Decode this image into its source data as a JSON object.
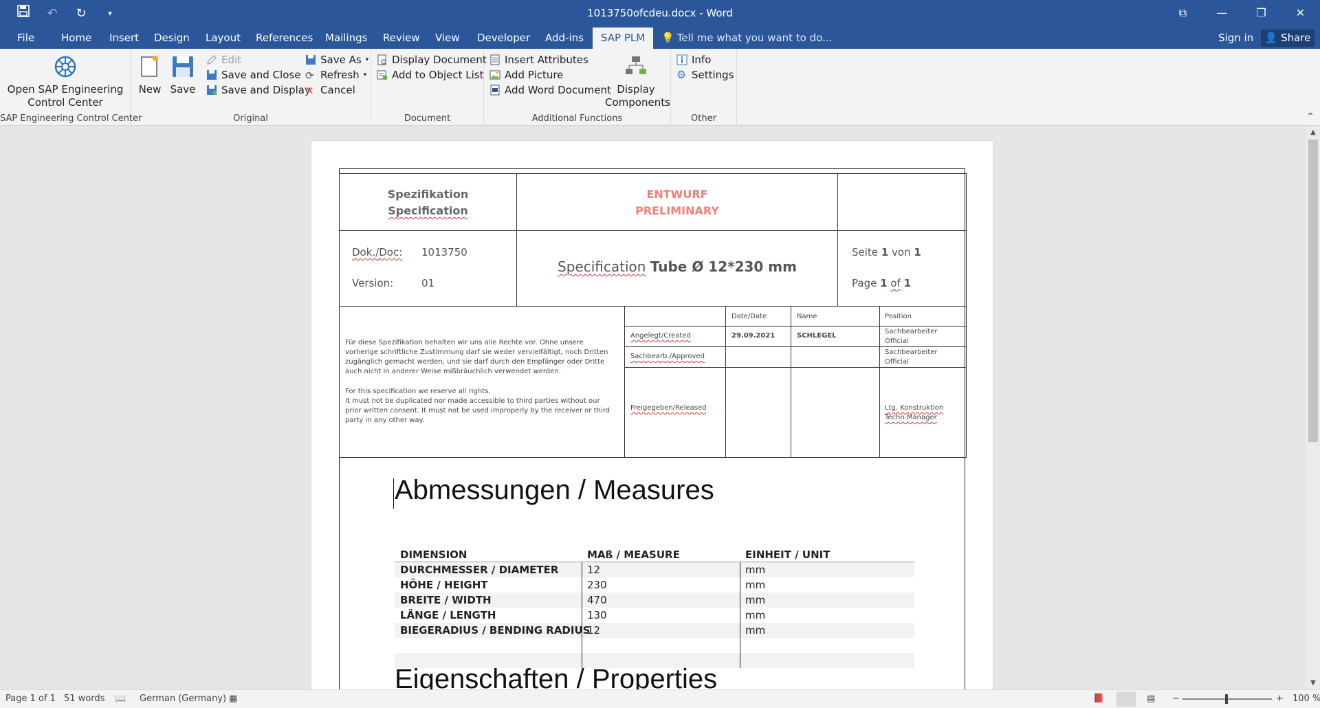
{
  "window": {
    "title": "1013750ofcdeu.docx - Word",
    "controls": [
      "ribbon-display-icon",
      "minimize-icon",
      "restore-icon",
      "close-icon"
    ]
  },
  "tabs": {
    "file": "File",
    "home": "Home",
    "insert": "Insert",
    "design": "Design",
    "layout": "Layout",
    "references": "References",
    "mailings": "Mailings",
    "review": "Review",
    "view": "View",
    "developer": "Developer",
    "addins": "Add-ins",
    "sapplm": "SAP PLM",
    "tell": "Tell me what you want to do...",
    "signin": "Sign in",
    "share": "Share"
  },
  "ribbon": {
    "g1": {
      "label": "SAP Engineering Control Center",
      "open_line1": "Open SAP Engineering",
      "open_line2": "Control Center"
    },
    "g2": {
      "label": "Original",
      "new": "New",
      "save": "Save",
      "edit": "Edit",
      "save_close": "Save and Close",
      "save_display": "Save and Display",
      "save_as": "Save As",
      "refresh": "Refresh",
      "cancel": "Cancel"
    },
    "g3": {
      "label": "Document",
      "display_doc": "Display Document",
      "add_obj": "Add to Object List"
    },
    "g4": {
      "label": "Additional Functions",
      "insert_attr": "Insert Attributes",
      "add_pic": "Add Picture",
      "add_word": "Add Word Document",
      "display_comp1": "Display",
      "display_comp2": "Components"
    },
    "g5": {
      "label": "Other",
      "info": "Info",
      "settings": "Settings"
    }
  },
  "doc": {
    "header": {
      "spec_de": "Spezifikation",
      "spec_en": "Specification",
      "draft_de": "ENTWURF",
      "draft_en": "PRELIMINARY",
      "doc_label": "Dok./Doc:",
      "doc_no": "1013750",
      "version_label": "Version:",
      "version": "01",
      "title_spec": "Specification",
      "title_rest": "Tube Ø 12*230 mm",
      "seite": "Seite",
      "von": "von",
      "page": "Page",
      "of": "of",
      "page_no": "1",
      "page_total": "1"
    },
    "rights": {
      "de": "Für diese Spezifikation behalten wir uns alle Rechte vor. Ohne unsere vorherige schriftliche Zustimmung darf sie weder vervielfältigt, noch Dritten zugänglich gemacht werden, und sie darf durch den Empfänger oder Dritte auch nicht in anderer Weise mißbräuchlich verwendet werden.",
      "en1": "For this specification we reserve all rights.",
      "en2": "It must not be duplicated nor made accessible to third parties without our prior written consent. It must not be used improperly by the receiver or third party in any other way."
    },
    "approval": {
      "col_date": "Date/Date",
      "col_name": "Name",
      "col_position": "Position",
      "created": "Angelegt/Created",
      "created_date": "29.09.2021",
      "created_name": "SCHLEGEL",
      "created_pos1": "Sachbearbeiter",
      "created_pos2": "Official",
      "approved": "Sachbearb./Approved",
      "approved_pos1": "Sachbearbeiter",
      "approved_pos2": "Official",
      "released": "Freigegeben/Released",
      "released_pos1": "Ltg. Konstruktion",
      "released_pos2": "Techn.Manager"
    },
    "measures": {
      "heading": "Abmessungen / Measures",
      "headers": [
        "DIMENSION",
        "MAß / MEASURE",
        "EINHEIT / UNIT"
      ],
      "rows": [
        [
          "DURCHMESSER / DIAMETER",
          "12",
          "mm"
        ],
        [
          "HÖHE / HEIGHT",
          "230",
          "mm"
        ],
        [
          "BREITE / WIDTH",
          "470",
          "mm"
        ],
        [
          "LÄNGE / LENGTH",
          "130",
          "mm"
        ],
        [
          "BIEGERADIUS / BENDING RADIUS",
          "12",
          "mm"
        ]
      ]
    },
    "properties_heading": "Eigenschaften / Properties"
  },
  "status": {
    "page": "Page 1 of 1",
    "words": "51 words",
    "language": "German (Germany)",
    "zoom": "100 %"
  },
  "colors": {
    "accent": "#2b579a",
    "draft": "#f08078"
  }
}
